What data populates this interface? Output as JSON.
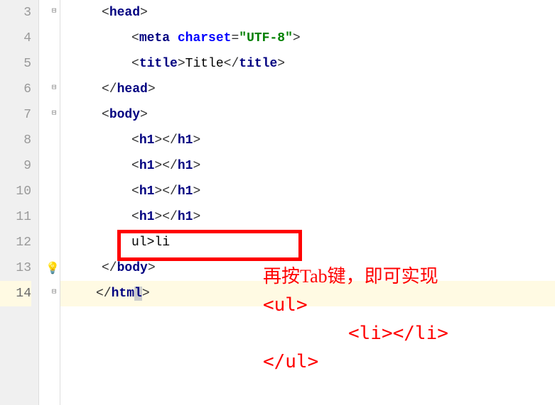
{
  "lines": {
    "l3": "3",
    "l4": "4",
    "l5": "5",
    "l6": "6",
    "l7": "7",
    "l8": "8",
    "l9": "9",
    "l10": "10",
    "l11": "11",
    "l12": "12",
    "l13": "13",
    "l14": "14"
  },
  "code": {
    "head_open": "head",
    "meta": "meta",
    "charset_attr": "charset",
    "charset_val": "\"UTF-8\"",
    "title_tag": "title",
    "title_text": "Title",
    "head_close": "head",
    "body_tag": "body",
    "h1_tag": "h1",
    "emmet": "ul>li",
    "html_close_pre": "htm",
    "html_close_l": "l"
  },
  "annotation": {
    "line1": "再按Tab键，即可实现",
    "line2": "<ul>",
    "line3": "<li></li>",
    "line4": "</ul>"
  }
}
